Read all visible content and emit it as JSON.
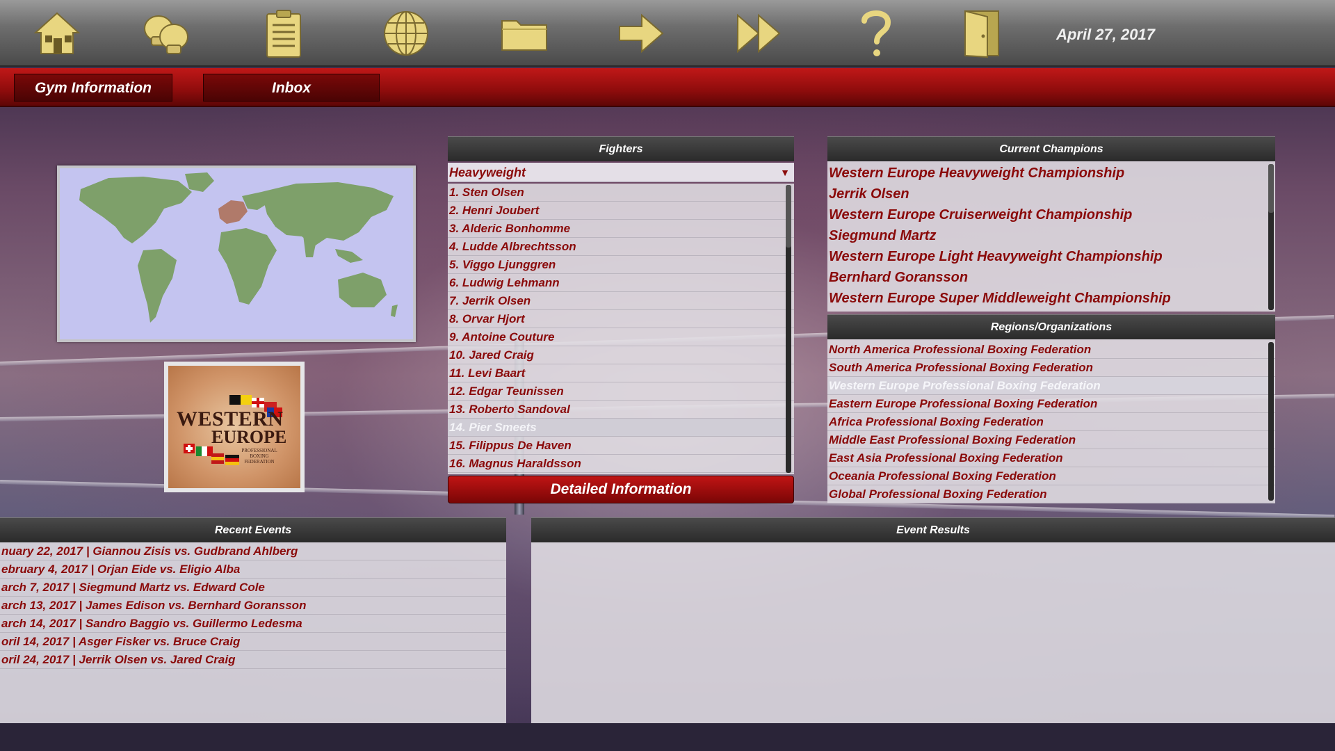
{
  "toolbar": {
    "icons": [
      "home-icon",
      "boxing-gloves-icon",
      "clipboard-icon",
      "globe-icon",
      "folder-icon",
      "arrow-right-icon",
      "fast-forward-icon",
      "help-icon",
      "exit-door-icon"
    ],
    "date": "April 27, 2017",
    "icon_color": "#e8d680"
  },
  "tabs": [
    {
      "label": "Gym Information"
    },
    {
      "label": "Inbox"
    }
  ],
  "fighters": {
    "title": "Fighters",
    "weight_class": "Heavyweight",
    "items": [
      "1. Sten Olsen",
      "2. Henri Joubert",
      "3. Alderic Bonhomme",
      "4. Ludde Albrechtsson",
      "5. Viggo Ljunggren",
      "6. Ludwig Lehmann",
      "7. Jerrik Olsen",
      "8. Orvar Hjort",
      "9. Antoine Couture",
      "10. Jared Craig",
      "11. Levi Baart",
      "12. Edgar Teunissen",
      "13. Roberto Sandoval",
      "14. Pier Smeets",
      "15. Filippus De Haven",
      "16. Magnus Haraldsson"
    ],
    "selected_index": 13,
    "button": "Detailed Information"
  },
  "champions": {
    "title": "Current Champions",
    "items": [
      "Western Europe Heavyweight Championship",
      "Jerrik Olsen",
      "Western Europe Cruiserweight Championship",
      "Siegmund Martz",
      "Western Europe Light Heavyweight Championship",
      "Bernhard Goransson",
      "Western Europe Super Middleweight Championship"
    ]
  },
  "regions": {
    "title": "Regions/Organizations",
    "items": [
      "North America Professional Boxing Federation",
      "South America Professional Boxing Federation",
      "Western Europe Professional Boxing Federation",
      "Eastern Europe Professional Boxing Federation",
      "Africa Professional Boxing Federation",
      "Middle East Professional Boxing Federation",
      "East Asia Professional Boxing Federation",
      "Oceania Professional Boxing Federation",
      "Global Professional Boxing Federation"
    ],
    "selected_index": 2
  },
  "logo": {
    "line1": "Western",
    "line2": "Europe",
    "line3": "Professional Boxing Federation"
  },
  "recent_events": {
    "title": "Recent Events",
    "items": [
      "nuary 22, 2017 | Giannou Zisis vs. Gudbrand Ahlberg",
      "ebruary 4, 2017 | Orjan Eide vs. Eligio Alba",
      "arch 7, 2017 | Siegmund Martz vs. Edward Cole",
      "arch 13, 2017 | James Edison vs. Bernhard Goransson",
      "arch 14, 2017 | Sandro Baggio vs. Guillermo Ledesma",
      "oril 14, 2017 | Asger Fisker vs. Bruce Craig",
      "oril 24, 2017 | Jerrik Olsen vs. Jared Craig"
    ]
  },
  "event_results": {
    "title": "Event Results"
  },
  "colors": {
    "accent_red": "#8a0a0a",
    "tabbar_red": "#c01818",
    "map_water": "#c4c4f0",
    "map_land": "#7ea06a",
    "map_highlight": "#b07a6a"
  }
}
